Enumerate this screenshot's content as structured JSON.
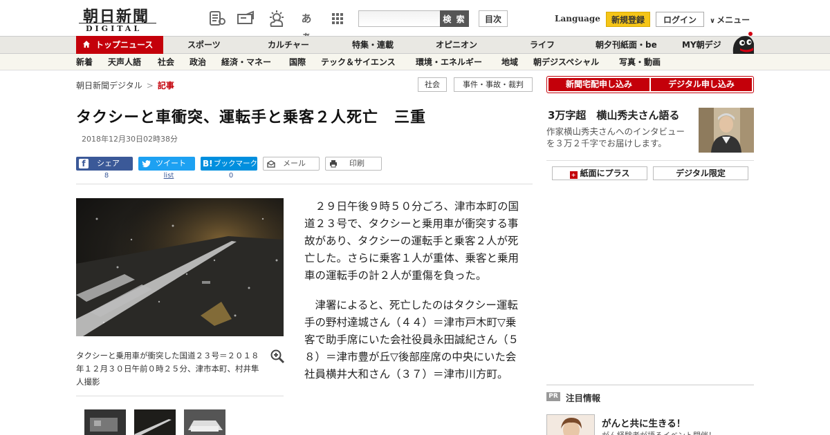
{
  "header": {
    "logo_kanji": "朝日新聞",
    "logo_digital": "DIGITAL",
    "icons": [
      "newspaper-icon",
      "megaphone-icon",
      "weather-icon",
      "font-size-icon",
      "grid-icon"
    ],
    "font_icon_text": "あぁ",
    "search_placeholder": "",
    "search_label": "検 索",
    "index_label": "目次",
    "language_label": "Language",
    "signup_label": "新規登録",
    "login_label": "ログイン",
    "menu_label": "メニュー"
  },
  "nav_main": {
    "items": [
      "トップニュース",
      "スポーツ",
      "カルチャー",
      "特集・連載",
      "オピニオン",
      "ライフ",
      "朝夕刊紙面・be",
      "MY朝デジ"
    ]
  },
  "nav_sub": {
    "items": [
      "新着",
      "天声人語",
      "社会",
      "政治",
      "経済・マネー",
      "国際",
      "テック＆サイエンス",
      "環境・エネルギー",
      "地域",
      "朝デジスペシャル",
      "写真・動画"
    ]
  },
  "breadcrumb": {
    "home": "朝日新聞デジタル",
    "sep": ">",
    "current": "記事"
  },
  "tags": [
    "社会",
    "事件・事故・裁判"
  ],
  "article": {
    "title": "タクシーと車衝突、運転手と乗客２人死亡　三重",
    "date": "2018年12月30日02時38分",
    "share": {
      "facebook_label": "シェア",
      "facebook_count": "8",
      "twitter_label": "ツイート",
      "twitter_count": "list",
      "hatena_label": "ブックマーク",
      "hatena_count": "0",
      "mail_label": "メール",
      "print_label": "印刷"
    },
    "photo_caption": "タクシーと乗用車が衝突した国道２３号＝２０１８年１２月３０日午前０時２５分、津市本町、村井隼人撮影",
    "paragraphs": [
      "２９日午後９時５０分ごろ、津市本町の国道２３号で、タクシーと乗用車が衝突する事故があり、タクシーの運転手と乗客２人が死亡した。さらに乗客１人が重体、乗客と乗用車の運転手の計２人が重傷を負った。",
      "津署によると、死亡したのはタクシー運転手の野村達城さん（４４）＝津市戸木町▽乗客で助手席にいた会社役員永田誠紀さん（５８）＝津市豊が丘▽後部座席の中央にいた会社員横井大和さん（３７）＝津市川方町。"
    ]
  },
  "sidebar": {
    "subscribe_paper": "新聞宅配申し込み",
    "subscribe_digital": "デジタル申し込み",
    "promo_title": "3万字超　横山秀夫さん語る",
    "promo_desc": "作家横山秀夫さんへのインタビューを３万２千字でお届けします。",
    "plus_label": "紙面にプラス",
    "digital_only_label": "デジタル限定",
    "pr_badge": "PR",
    "pr_label": "注目情報",
    "pr_title": "がんと共に生きる！",
    "pr_sub": "がん経験者が語るイベント開催！"
  }
}
